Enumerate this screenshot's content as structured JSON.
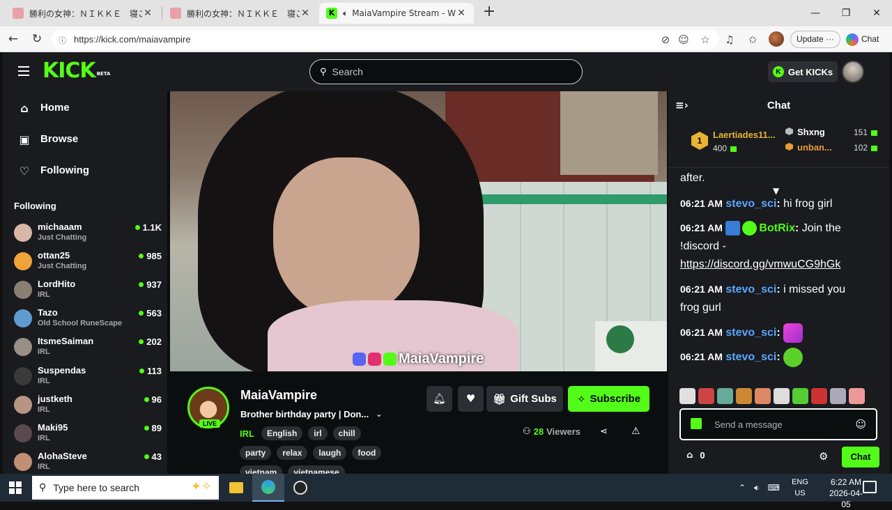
{
  "browser": {
    "tabs": [
      {
        "title": "勝利の女神：ＮＩＫＫＥ　寝ころび",
        "active": false
      },
      {
        "title": "勝利の女神：ＮＩＫＫＥ　寝ころび",
        "active": false
      },
      {
        "title": "MaiaVampire Stream - Watch",
        "active": true
      }
    ],
    "url": "https://kick.com/maiavampire",
    "update_label": "Update",
    "update_more": "···",
    "chat_label": "Chat"
  },
  "kick": {
    "logo": "KICK",
    "logo_badge": "BETA",
    "search_placeholder": "Search",
    "get_kicks_label": "Get KICKs",
    "get_kicks_icon": "K",
    "nav": [
      {
        "label": "Home",
        "icon": "home-icon"
      },
      {
        "label": "Browse",
        "icon": "browse-icon"
      },
      {
        "label": "Following",
        "icon": "heart-icon"
      }
    ],
    "following_heading": "Following",
    "following": [
      {
        "name": "michaaam",
        "category": "Just Chatting",
        "viewers": "1.1K",
        "color": "#d9b7a6"
      },
      {
        "name": "ottan25",
        "category": "Just Chatting",
        "viewers": "985",
        "color": "#f0a33a"
      },
      {
        "name": "LordHito",
        "category": "IRL",
        "viewers": "937",
        "color": "#8a7f72"
      },
      {
        "name": "Tazo",
        "category": "Old School RuneScape",
        "viewers": "563",
        "color": "#5f9bd1"
      },
      {
        "name": "ItsmeSaiman",
        "category": "IRL",
        "viewers": "202",
        "color": "#9a8f86"
      },
      {
        "name": "Suspendas",
        "category": "IRL",
        "viewers": "113",
        "color": "#3a3a3a"
      },
      {
        "name": "justketh",
        "category": "IRL",
        "viewers": "96",
        "color": "#b89483"
      },
      {
        "name": "Maki95",
        "category": "IRL",
        "viewers": "89",
        "color": "#5a4a4f"
      },
      {
        "name": "AlohaSteve",
        "category": "IRL",
        "viewers": "43",
        "color": "#c08f74"
      }
    ]
  },
  "stream": {
    "overlay_name": "MaiaVampire",
    "channel": "MaiaVampire",
    "live_label": "LIVE",
    "title": "Brother birthday party | Don...",
    "category": "IRL",
    "tags_row1": [
      "English",
      "irl",
      "chill"
    ],
    "tags_row2": [
      "party",
      "relax",
      "laugh",
      "food"
    ],
    "tags_row3": [
      "vietnam",
      "vietnamese"
    ],
    "gift_subs_label": "Gift Subs",
    "subscribe_label": "Subscribe",
    "viewers_count": "28",
    "viewers_label": "Viewers"
  },
  "chat": {
    "header": "Chat",
    "top_gifters": [
      {
        "rank": "1",
        "name": "Laertiades11...",
        "amount": "400"
      },
      {
        "name": "Shxng",
        "amount": "151"
      },
      {
        "name": "unban...",
        "amount": "102"
      }
    ],
    "messages": [
      {
        "time": "",
        "user": "",
        "text": "after."
      },
      {
        "time": "06:21 AM",
        "user": "stevo_sci",
        "text": "hi frog girl"
      },
      {
        "time": "06:21 AM",
        "user": "BotRix",
        "text": "Join the",
        "text2": "!discord -",
        "link": "https://discord.gg/vmwuCG9hGk"
      },
      {
        "time": "06:21 AM",
        "user": "stevo_sci",
        "text": "i missed you",
        "text2": "frog gurl"
      },
      {
        "time": "06:21 AM",
        "user": "stevo_sci",
        "text": ""
      },
      {
        "time": "06:21 AM",
        "user": "stevo_sci",
        "text": ""
      }
    ],
    "colon": ":",
    "input_placeholder": "Send a message",
    "points": "0",
    "chat_button": "Chat"
  },
  "taskbar": {
    "search_placeholder": "Type here to search",
    "lang1": "ENG",
    "lang2": "US",
    "time": "6:22 AM",
    "date": "2026-04-05"
  }
}
